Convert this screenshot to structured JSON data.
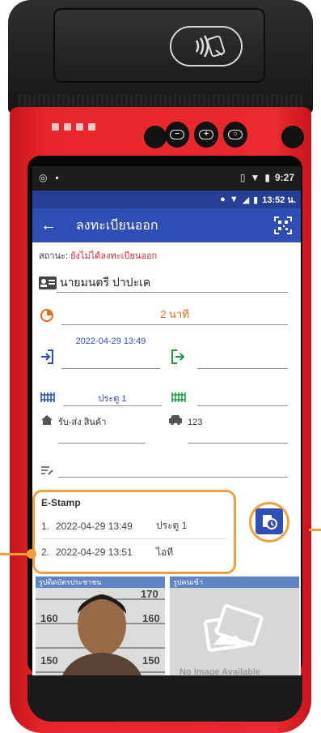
{
  "system_bar": {
    "time": "9:27"
  },
  "app_status": {
    "time": "13:52 น."
  },
  "app_bar": {
    "title": "ลงทะเบียนออก"
  },
  "status": {
    "label": "สถานะ: ",
    "value": "ยังไม่ได้ลงทะเบียนออก"
  },
  "visitor": {
    "name": "นายมนตรี ปาปะเค"
  },
  "duration": {
    "value": "2 นาที"
  },
  "entry": {
    "datetime": "2022-04-29 13:49",
    "exit_datetime": ""
  },
  "gate": {
    "entry_gate": "ประตู 1",
    "exit_gate": ""
  },
  "purpose": {
    "value": "รับ-ส่ง สินค้า"
  },
  "vehicle": {
    "plate": "123"
  },
  "note": {
    "value": ""
  },
  "estamp": {
    "title": "E-Stamp",
    "rows": [
      {
        "idx": "1.",
        "datetime": "2022-04-29 13:49",
        "place": "ประตู 1"
      },
      {
        "idx": "2.",
        "datetime": "2022-04-29 13:51",
        "place": "ไอที"
      }
    ]
  },
  "photos": {
    "id_card_label": "รูปติดบัตรประชาชน",
    "visitor_photo_label": "รูปคนเข้า",
    "no_image_text": "No Image Available"
  },
  "colors": {
    "primary": "#2f4fb6",
    "accent": "#f1a040",
    "warning": "#e3262b",
    "duration": "#e2691b",
    "device": "#e8252b"
  }
}
